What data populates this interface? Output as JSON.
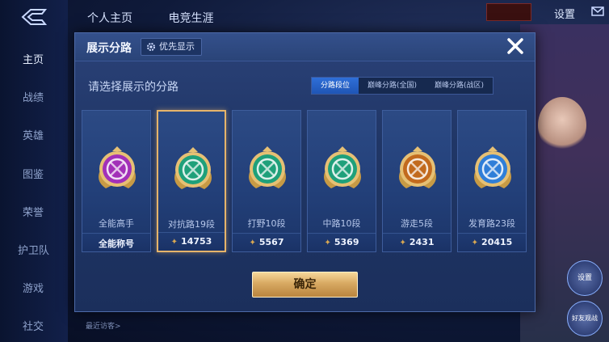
{
  "background": {
    "nav_items": [
      "主页",
      "战绩",
      "英雄",
      "图鉴",
      "荣誉",
      "护卫队",
      "游戏",
      "社交"
    ],
    "top_tabs": [
      "个人主页",
      "电竞生涯"
    ],
    "settings_label": "设置",
    "recent_visitors_label": "最近访客>",
    "side_buttons": [
      "设置",
      "好友观战"
    ]
  },
  "modal": {
    "title": "展示分路",
    "priority_label": "优先显示",
    "subtitle": "请选择展示的分路",
    "tabs": [
      "分路段位",
      "巅峰分路(全国)",
      "巅峰分路(战区)"
    ],
    "active_tab": 0,
    "cards": [
      {
        "name": "全能高手",
        "stat": "全能称号",
        "has_star": false,
        "emblem": "all-round-emblem-icon",
        "selected": false,
        "gem": "#a230b8"
      },
      {
        "name": "对抗路19段",
        "stat": "14753",
        "has_star": true,
        "emblem": "clash-lane-emblem-icon",
        "selected": true,
        "gem": "#1fa07a"
      },
      {
        "name": "打野10段",
        "stat": "5567",
        "has_star": true,
        "emblem": "jungle-emblem-icon",
        "selected": false,
        "gem": "#1fa07a"
      },
      {
        "name": "中路10段",
        "stat": "5369",
        "has_star": true,
        "emblem": "mid-lane-emblem-icon",
        "selected": false,
        "gem": "#1fa07a"
      },
      {
        "name": "游走5段",
        "stat": "2431",
        "has_star": true,
        "emblem": "roam-emblem-icon",
        "selected": false,
        "gem": "#c26a1e"
      },
      {
        "name": "发育路23段",
        "stat": "20415",
        "has_star": true,
        "emblem": "farm-lane-emblem-icon",
        "selected": false,
        "gem": "#2f7ed8"
      }
    ],
    "confirm_label": "确定"
  },
  "colors": {
    "accent_gold": "#d8a962",
    "tab_active": "#2f6fd8"
  }
}
